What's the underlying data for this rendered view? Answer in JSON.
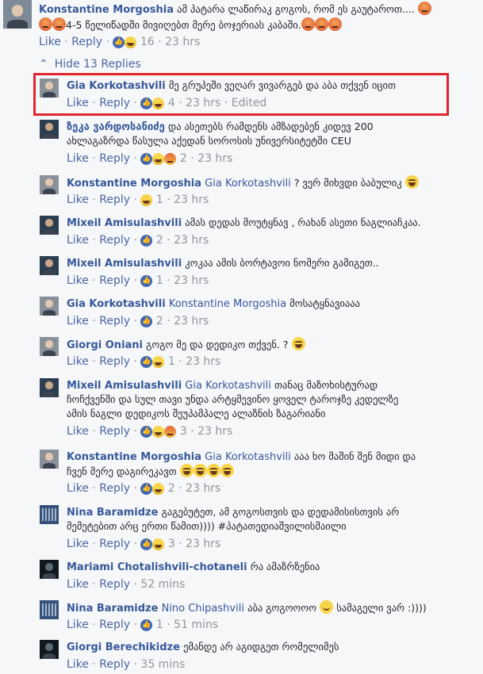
{
  "top_comment": {
    "author": "Konstantine Morgoshia",
    "text_line1": "ამ პატარა ლაწირაკ გოგოს, რომ ეს გაუტაროთ....",
    "text_line2": "4-5 წელიწადში მივიღებთ მერე ბოჯერიას კაბაში.",
    "like_label": "Like",
    "reply_label": "Reply",
    "reaction_count": "16",
    "time": "23 hrs"
  },
  "hide_replies_label": "Hide 13 Replies",
  "replies": [
    {
      "author": "Gia Korkotashvili",
      "mention": "",
      "text": "მე გრუპეში ვეღარ ვივარგებ და აბა თქვენ იცით",
      "count": "4",
      "time": "23 hrs",
      "edited": "Edited",
      "reactions": [
        "like-icon",
        "haha-icon"
      ]
    },
    {
      "author": "ზეკა ვარდოსანიძე",
      "mention": "",
      "text": "და ასეთებს რამდენს ამზადებენ კიდევ 200",
      "text2": "ახლაგაზრდა წასულა აქედან სოროსის უნივერსიტეტში CEU",
      "count": "2",
      "time": "23 hrs",
      "reactions": [
        "like-icon",
        "haha-icon",
        "angry-icon"
      ]
    },
    {
      "author": "Konstantine Morgoshia",
      "mention": "Gia Korkotashvili",
      "text": "? ვერ მიხვდი ბაბულიკ",
      "count": "1",
      "time": "23 hrs",
      "reactions": [
        "haha-icon"
      ]
    },
    {
      "author": "Mixeil Amisulashvili",
      "mention": "",
      "text": "ამას დედას მოუტყნავ , რახან ასეთი ნაგლიაჩკაა.",
      "count": "2",
      "time": "23 hrs",
      "reactions": [
        "like-icon"
      ]
    },
    {
      "author": "Mixeil Amisulashvili",
      "mention": "",
      "text": "კოკაა ამის ბორტავოი ნომერი გამიგეთ..",
      "count": "1",
      "time": "23 hrs",
      "reactions": [
        "like-icon"
      ]
    },
    {
      "author": "Gia Korkotashvili",
      "mention": "Konstantine Morgoshia",
      "text": "მოსატყნავიააა",
      "count": "2",
      "time": "23 hrs",
      "reactions": [
        "like-icon"
      ]
    },
    {
      "author": "Giorgi Oniani",
      "mention": "",
      "text": "გოგო მე და დედიკო თქვენ. ?",
      "count": "1",
      "time": "23 hrs",
      "reactions": [
        "like-icon",
        "haha-icon"
      ]
    },
    {
      "author": "Mixeil Amisulashvili",
      "mention": "Gia Korkotashvili",
      "text": "თანაც მაზოხისტურად",
      "text2": "ჩოჩქვენში და სულ თავი უნდა არტყმევინო ყოველ ტაროჯზე კედელზე",
      "text3": "ამის ნაგლი დედიკოს შეუპამპალე ალაზნის ზაგარიანი",
      "count": "3",
      "time": "23 hrs",
      "reactions": [
        "like-icon",
        "haha-icon",
        "angry-icon"
      ]
    },
    {
      "author": "Konstantine Morgoshia",
      "mention": "Gia Korkotashvili",
      "text": "ააა ხო მაშინ შენ მიდი და",
      "text2": "ჩვენ მერე დაგირეკავთ",
      "count": "2",
      "time": "23 hrs",
      "reactions": [
        "like-icon",
        "haha-icon"
      ]
    },
    {
      "author": "Nina Baramidze",
      "mention": "",
      "text": "გაგებუტეთ, ამ გოგოსთვის და დედამისისთვის არ",
      "text2": "მემეტებით არც ერთი წამით)))) #პატათედიაშვილისმაილი",
      "count": "3",
      "time": "23 hrs",
      "reactions": [
        "like-icon",
        "haha-icon"
      ]
    },
    {
      "author": "Mariami Chotalishvili-chotaneli",
      "mention": "",
      "text": "რა ამაზრზენია",
      "count": "",
      "time": "52 mins",
      "reactions": []
    },
    {
      "author": "Nina Baramidze",
      "mention": "Nino Chipashvili",
      "text": "აბა გოგოოოო",
      "text_after": "სამაგელი ვარ :))))",
      "count": "1",
      "time": "51 mins",
      "reactions": [
        "like-icon"
      ]
    },
    {
      "author": "Giorgi Berechikidze",
      "mention": "",
      "text": "ემანდე არ აგიდგეთ რომელიმეს",
      "count": "",
      "time": "35 mins",
      "reactions": []
    }
  ],
  "like_label": "Like",
  "reply_label": "Reply",
  "colors": {
    "name": "#365899",
    "meta": "#90949c",
    "highlight": "#e0262f",
    "like": "#4267b2"
  }
}
